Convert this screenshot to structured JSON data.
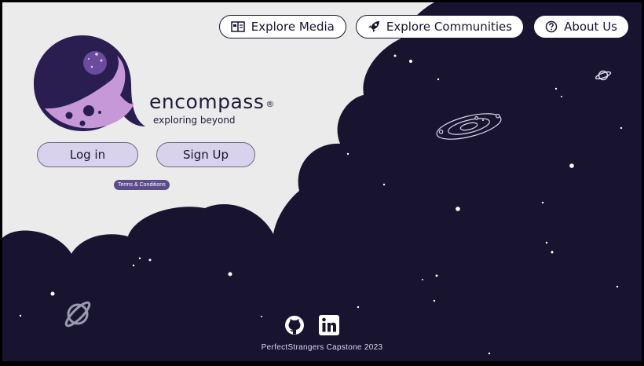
{
  "nav": {
    "explore_media": "Explore Media",
    "explore_communities": "Explore Communities",
    "about_us": "About Us"
  },
  "brand": {
    "name": "encompass",
    "registered": "®",
    "tagline": "exploring beyond"
  },
  "auth": {
    "login": "Log in",
    "signup": "Sign Up",
    "terms": "Terms & Conditions"
  },
  "footer": {
    "credit": "PerfectStrangers Capstone 2023",
    "icons": [
      "github-icon",
      "linkedin-icon"
    ]
  },
  "colors": {
    "space": "#181430",
    "background": "#ebebeb",
    "button": "#d8d2ec",
    "logo_purple": "#c698d8",
    "terms_badge": "#5b4c8a"
  }
}
